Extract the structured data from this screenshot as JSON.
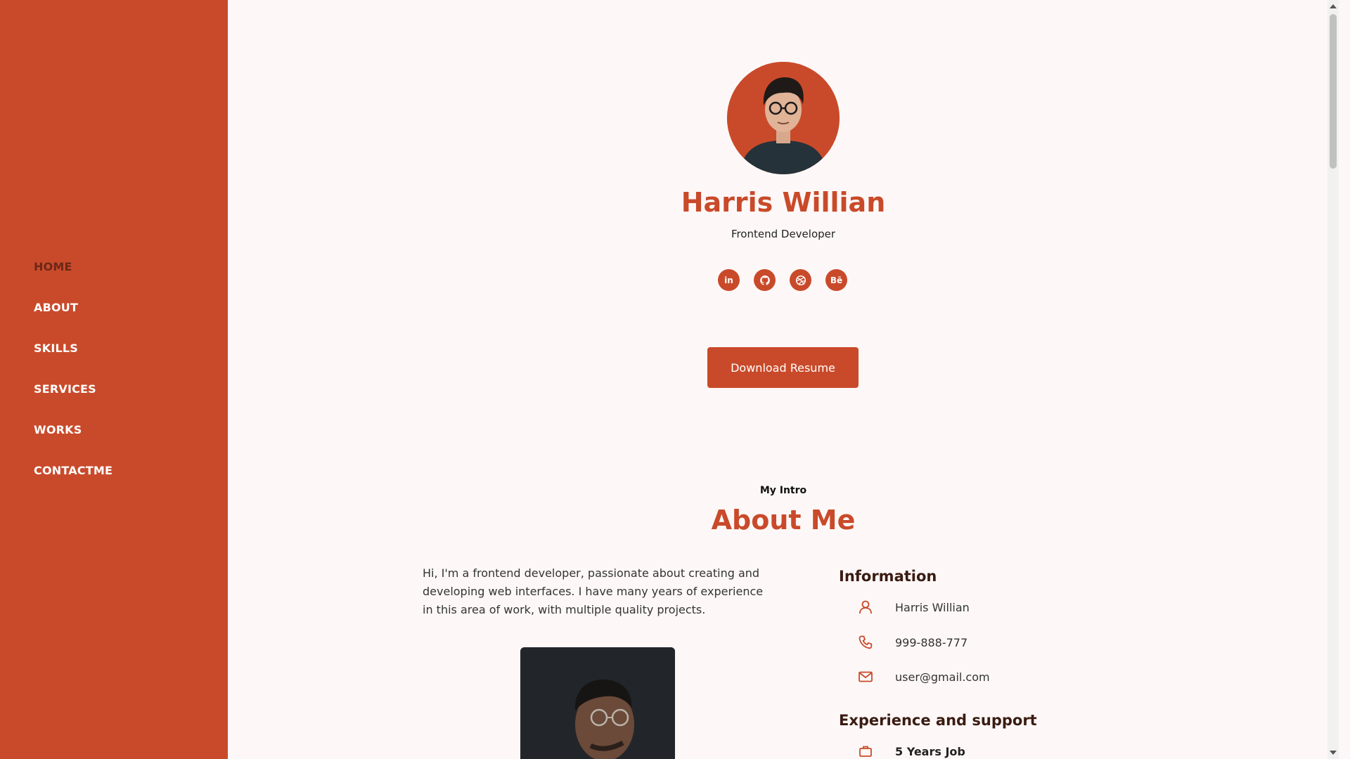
{
  "nav": {
    "items": [
      {
        "label": "HOME",
        "active": true
      },
      {
        "label": "ABOUT"
      },
      {
        "label": "SKILLS"
      },
      {
        "label": "SERVICES"
      },
      {
        "label": "WORKS"
      },
      {
        "label": "CONTACTME"
      }
    ]
  },
  "hero": {
    "name": "Harris Willian",
    "role": "Frontend Developer",
    "socials": [
      {
        "icon": "linkedin-icon",
        "glyph": "in"
      },
      {
        "icon": "github-icon",
        "glyph": ""
      },
      {
        "icon": "dribbble-icon",
        "glyph": ""
      },
      {
        "icon": "behance-icon",
        "glyph": "Bē"
      }
    ],
    "download_label": "Download Resume"
  },
  "about": {
    "subtitle": "My Intro",
    "title": "About Me",
    "text": "Hi, I'm a frontend developer, passionate about creating and developing web interfaces. I have many years of experience in this area of work, with multiple quality projects.",
    "info_heading": "Information",
    "info": [
      {
        "icon": "user-icon",
        "value": "Harris Willian"
      },
      {
        "icon": "phone-icon",
        "value": "999-888-777"
      },
      {
        "icon": "mail-icon",
        "value": "user@gmail.com"
      }
    ],
    "experience_heading": "Experience and support",
    "experience": [
      {
        "icon": "briefcase-icon",
        "value": "5 Years Job"
      }
    ]
  },
  "colors": {
    "accent": "#c94a2a",
    "background": "#fdf8f7",
    "active_nav": "#6b2818"
  }
}
